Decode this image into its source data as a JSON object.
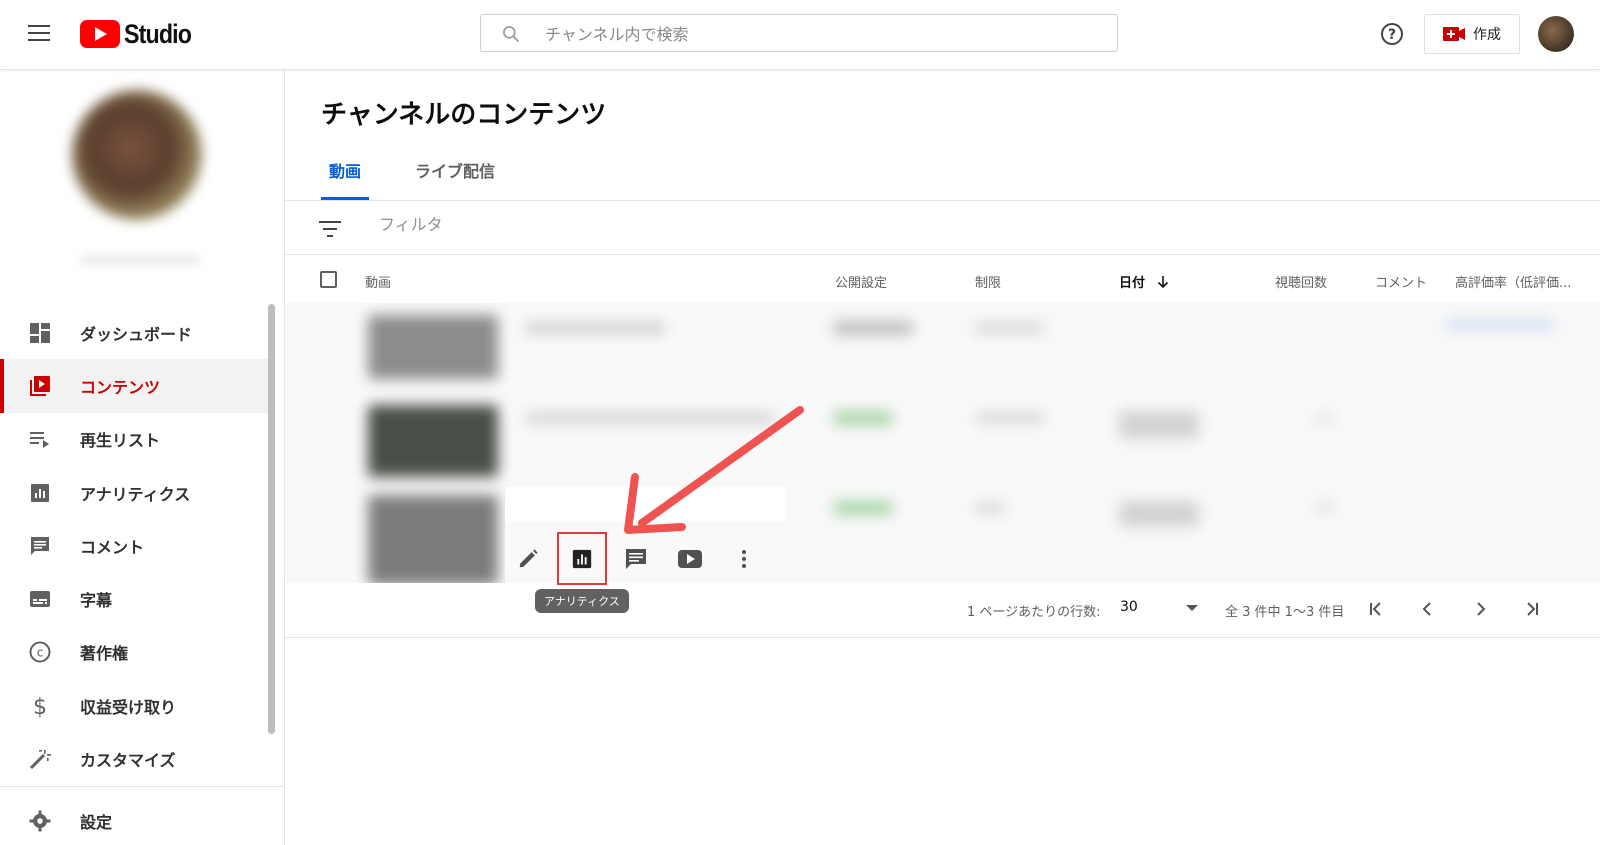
{
  "header": {
    "logo_text": "Studio",
    "search_placeholder": "チャンネル内で検索",
    "create_label": "作成"
  },
  "sidebar": {
    "items": [
      {
        "label": "ダッシュボード",
        "icon": "dashboard-icon",
        "active": false
      },
      {
        "label": "コンテンツ",
        "icon": "content-icon",
        "active": true
      },
      {
        "label": "再生リスト",
        "icon": "playlist-icon",
        "active": false
      },
      {
        "label": "アナリティクス",
        "icon": "analytics-icon",
        "active": false
      },
      {
        "label": "コメント",
        "icon": "comment-icon",
        "active": false
      },
      {
        "label": "字幕",
        "icon": "subtitles-icon",
        "active": false
      },
      {
        "label": "著作権",
        "icon": "copyright-icon",
        "active": false
      },
      {
        "label": "収益受け取り",
        "icon": "dollar-icon",
        "active": false
      },
      {
        "label": "カスタマイズ",
        "icon": "magic-wand-icon",
        "active": false
      }
    ],
    "settings_label": "設定"
  },
  "main": {
    "title": "チャンネルのコンテンツ",
    "tabs": [
      {
        "label": "動画",
        "active": true
      },
      {
        "label": "ライブ配信",
        "active": false
      }
    ],
    "filter_placeholder": "フィルタ",
    "columns": {
      "video": "動画",
      "visibility": "公開設定",
      "restrictions": "制限",
      "date": "日付",
      "views": "視聴回数",
      "comments": "コメント",
      "likes": "高評価率（低評価..."
    },
    "tooltip": "アナリティクス",
    "pagination": {
      "rows_per_page_label": "1 ページあたりの行数:",
      "rows_per_page_value": "30",
      "range_label": "全 3 件中 1～3 件目"
    }
  },
  "colors": {
    "brand_red": "#ff0000",
    "active_red": "#cc0000",
    "tab_blue": "#065fd4",
    "annotation_red": "#e23b3b"
  }
}
